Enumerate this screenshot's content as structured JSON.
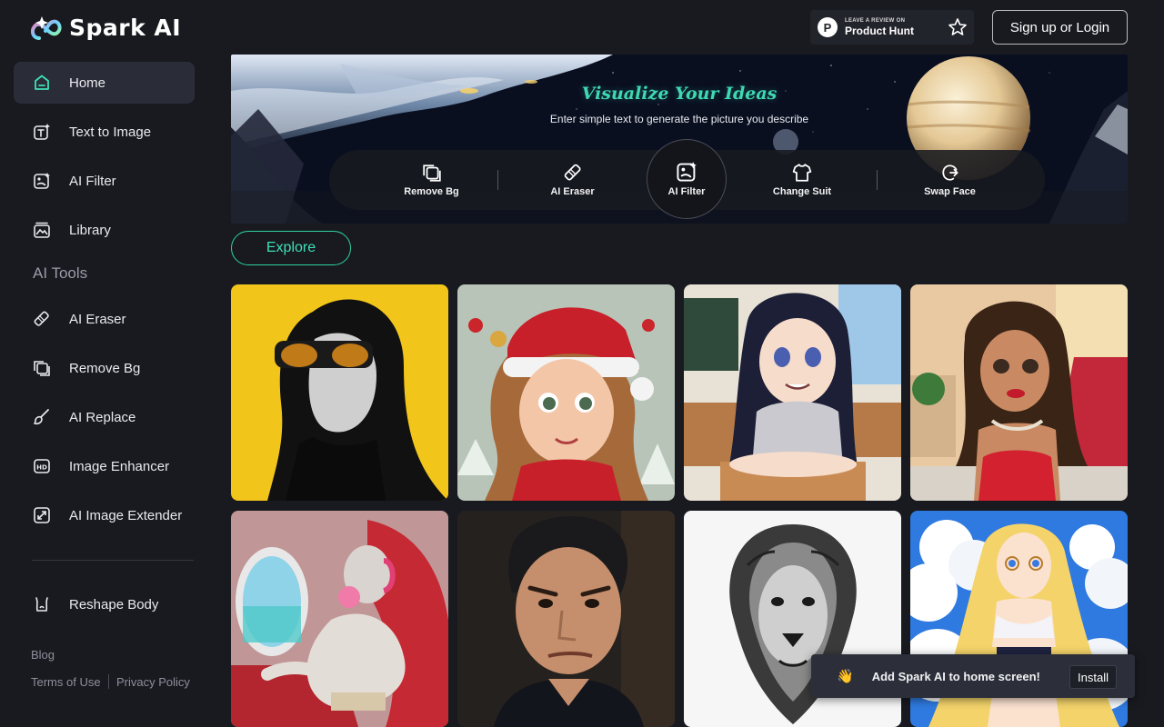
{
  "brand": {
    "name": "Spark AI"
  },
  "sidebar": {
    "items": [
      {
        "label": "Home",
        "icon": "home-icon",
        "active": true
      },
      {
        "label": "Text to Image",
        "icon": "text-to-image-icon"
      },
      {
        "label": "AI Filter",
        "icon": "ai-filter-icon"
      },
      {
        "label": "Library",
        "icon": "library-icon"
      }
    ],
    "section_title": "AI Tools",
    "tools": [
      {
        "label": "AI Eraser",
        "icon": "eraser-icon"
      },
      {
        "label": "Remove Bg",
        "icon": "remove-bg-icon"
      },
      {
        "label": "AI Replace",
        "icon": "brush-icon"
      },
      {
        "label": "Image Enhancer",
        "icon": "hd-icon"
      },
      {
        "label": "AI Image Extender",
        "icon": "expand-icon"
      }
    ],
    "extra": {
      "label": "Reshape Body",
      "icon": "body-icon"
    },
    "footer": {
      "blog": "Blog",
      "terms": "Terms of Use",
      "privacy": "Privacy Policy"
    }
  },
  "header": {
    "product_hunt": {
      "small": "LEAVE A REVIEW ON",
      "big": "Product Hunt",
      "letter": "P"
    },
    "login": "Sign up or Login"
  },
  "hero": {
    "title": "Visualize Your Ideas",
    "subtitle": "Enter simple text to generate the picture you describe",
    "tools": [
      {
        "label": "Remove Bg",
        "icon": "remove-bg-icon"
      },
      {
        "label": "AI Eraser",
        "icon": "eraser-icon"
      },
      {
        "label": "AI Filter",
        "icon": "ai-filter-icon",
        "selected": true
      },
      {
        "label": "Change Suit",
        "icon": "shirt-icon"
      },
      {
        "label": "Swap Face",
        "icon": "swap-face-icon"
      }
    ]
  },
  "explore": "Explore",
  "gallery": [
    {
      "subject": "woman-sunglasses-yellow"
    },
    {
      "subject": "christmas-girl"
    },
    {
      "subject": "anime-girl-classroom"
    },
    {
      "subject": "woman-red-dress"
    },
    {
      "subject": "statue-airplane"
    },
    {
      "subject": "man-portrait"
    },
    {
      "subject": "lion-sketch"
    },
    {
      "subject": "anime-girl-sky"
    }
  ],
  "toast": {
    "emoji": "👋",
    "text": "Add Spark AI to home screen!",
    "button": "Install"
  },
  "colors": {
    "accent": "#3fe0b6",
    "background": "#181a20",
    "active": "#2a2c38"
  }
}
